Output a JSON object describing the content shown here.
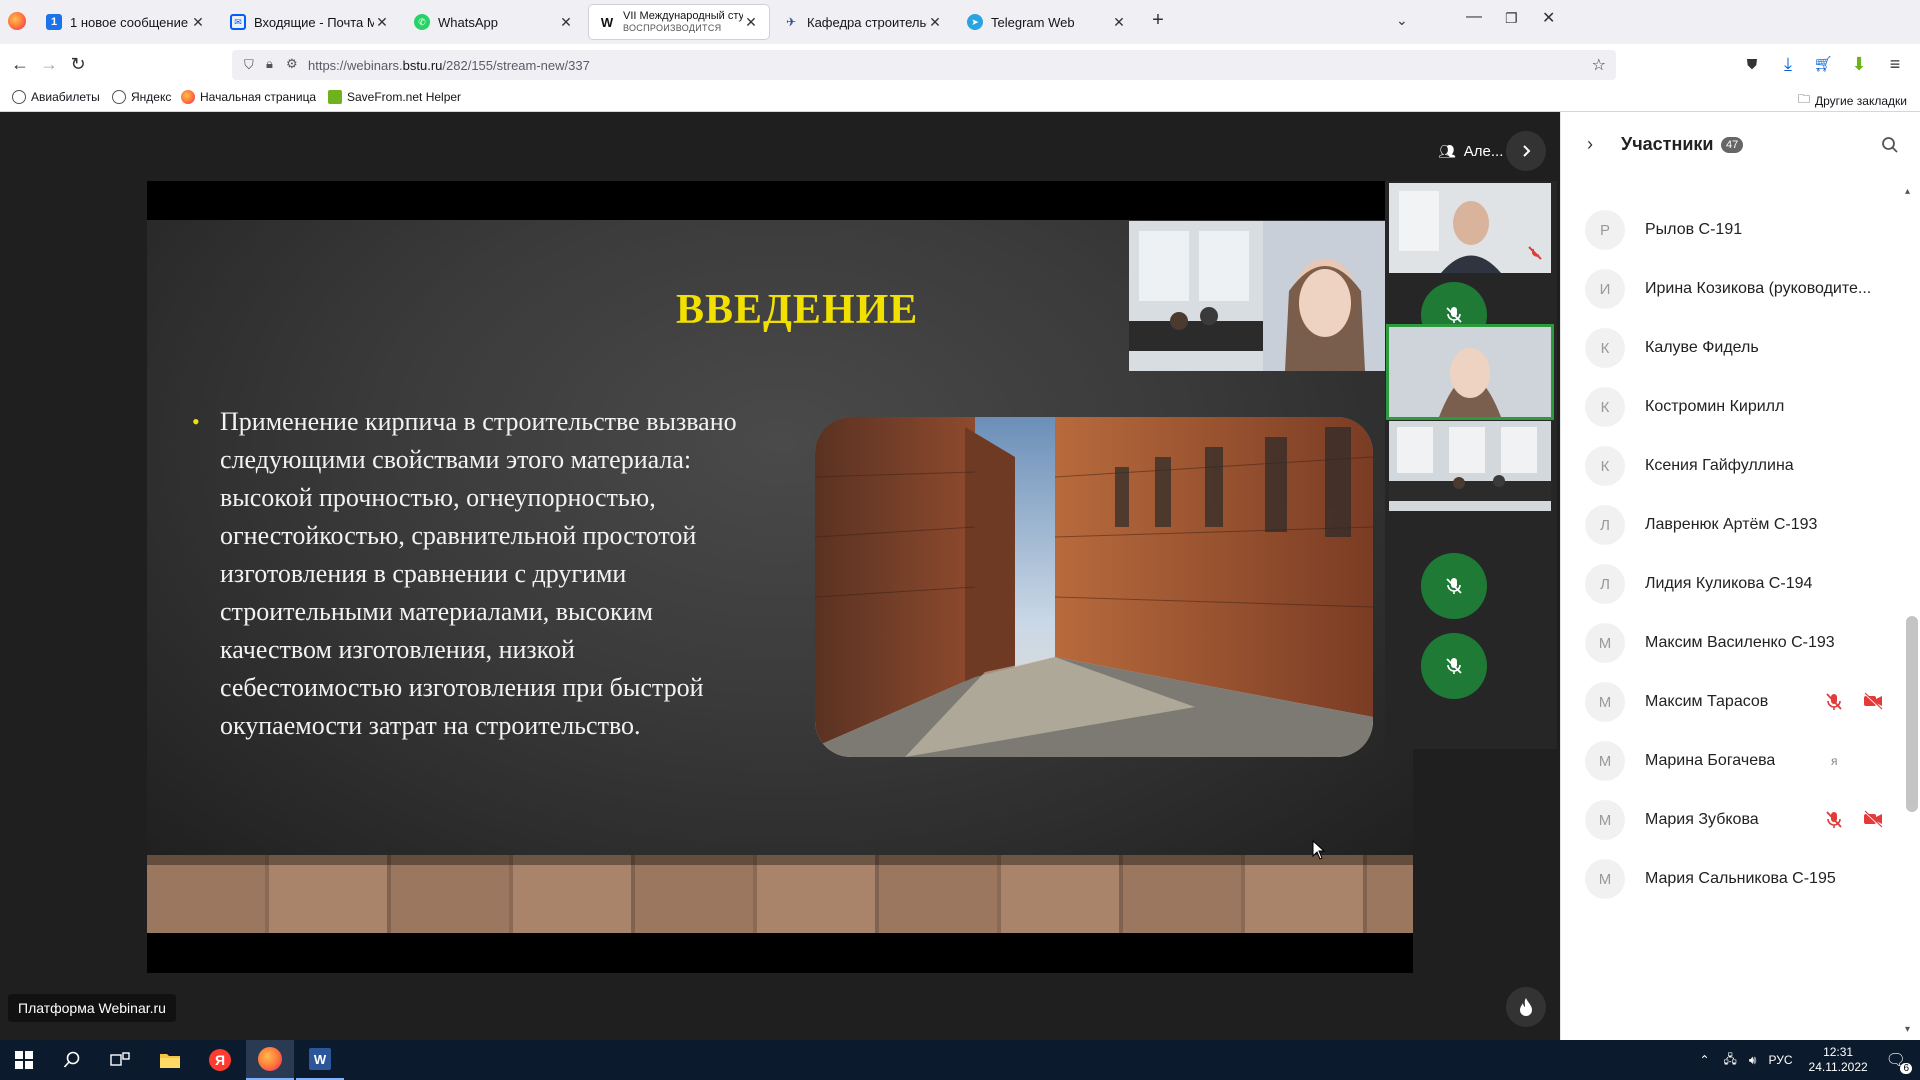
{
  "browser": {
    "tabs": [
      {
        "title": "1 новое сообщение",
        "favicon": "mail-badge-icon",
        "badge": "1"
      },
      {
        "title": "Входящие - Почта Mail.ru",
        "favicon": "mailru-icon"
      },
      {
        "title": "WhatsApp",
        "favicon": "whatsapp-icon"
      },
      {
        "title": "VII Международный студенческ",
        "subtitle": "ВОСПРОИЗВОДИТСЯ",
        "favicon": "webinar-w-icon",
        "badge": "W"
      },
      {
        "title": "Кафедра строительства и горо",
        "favicon": "bstu-icon"
      },
      {
        "title": "Telegram Web",
        "favicon": "telegram-icon"
      }
    ],
    "url_prefix": "https://webinars.",
    "url_domain": "bstu.ru",
    "url_path": "/282/155/stream-new/337",
    "bookmarks": [
      "Авиабилеты",
      "Яндекс",
      "Начальная страница",
      "SaveFrom.net Helper"
    ],
    "other_bookmarks": "Другие закладки"
  },
  "webinar": {
    "speaker_name": "Але...",
    "slide": {
      "title": "ВВЕДЕНИЕ",
      "bullet": "Применение кирпича в строительстве вызвано следующими свойствами этого материала: высокой прочностью, огнеупорностью, огнестойкостью, сравнительной простотой изготовления в сравнении с другими строительными материалами, высоким качеством изготовления, низкой себестоимостью изготовления при быстрой окупаемости затрат на строительство."
    },
    "platform_label": "Платформа Webinar.ru"
  },
  "participants": {
    "title": "Участники",
    "count": "47",
    "list": [
      {
        "initial": "Р",
        "name": "Рылов С-191"
      },
      {
        "initial": "И",
        "name": "Ирина Козикова (руководите..."
      },
      {
        "initial": "К",
        "name": "Калуве Фидель"
      },
      {
        "initial": "К",
        "name": "Костромин Кирилл"
      },
      {
        "initial": "К",
        "name": "Ксения Гайфуллина"
      },
      {
        "initial": "Л",
        "name": "Лавренюк Артём С-193"
      },
      {
        "initial": "Л",
        "name": "Лидия Куликова С-194"
      },
      {
        "initial": "М",
        "name": "Максим Василенко С-193"
      },
      {
        "initial": "М",
        "name": "Максим Тарасов",
        "mic_off": true,
        "cam_off": true
      },
      {
        "initial": "М",
        "name": "Марина Богачева",
        "tag": "я"
      },
      {
        "initial": "М",
        "name": "Мария Зубкова",
        "mic_off": true,
        "cam_off": true
      },
      {
        "initial": "М",
        "name": "Мария Сальникова С-195"
      }
    ]
  },
  "taskbar": {
    "lang": "РУС",
    "time": "12:31",
    "date": "24.11.2022",
    "notifications": "6"
  }
}
